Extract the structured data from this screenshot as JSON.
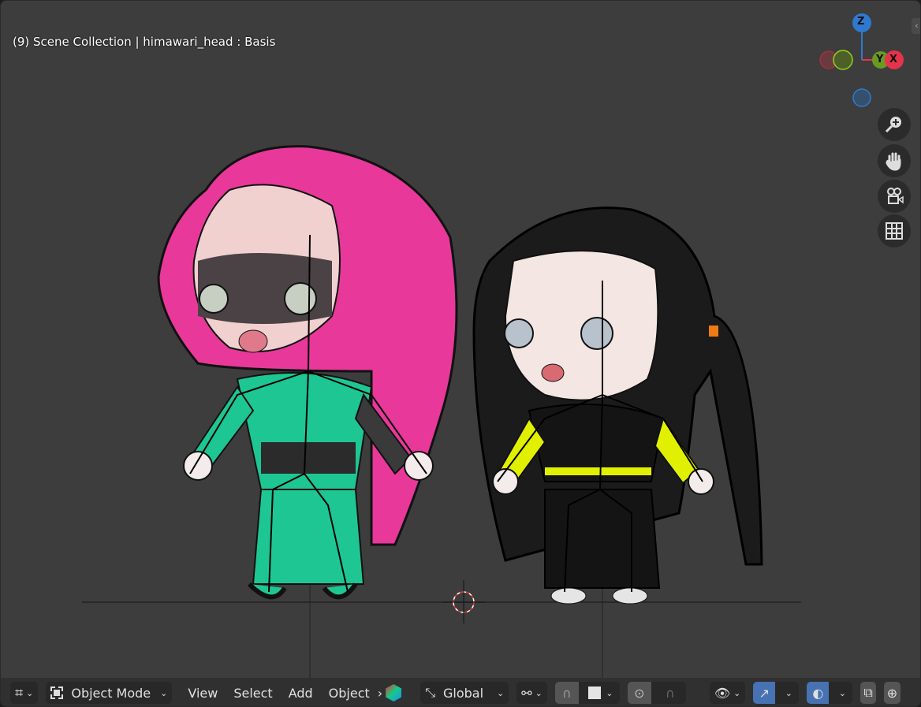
{
  "header": {
    "title": "(9) Scene Collection | himawari_head : Basis"
  },
  "gizmo": {
    "axes": [
      "Z",
      "Y",
      "X"
    ],
    "colors": {
      "x": "#e5334c",
      "y": "#6a9a23",
      "z": "#2f7ad0"
    }
  },
  "nav_buttons": [
    "zoom-icon",
    "pan-hand-icon",
    "camera-icon",
    "grid-ortho-icon"
  ],
  "toolbar": {
    "editor_type_icon": "3d-viewport-icon",
    "mode": "Object Mode",
    "menus": [
      "View",
      "Select",
      "Add",
      "Object"
    ],
    "transform_orientation": "Global",
    "accent": "#4772b3"
  }
}
